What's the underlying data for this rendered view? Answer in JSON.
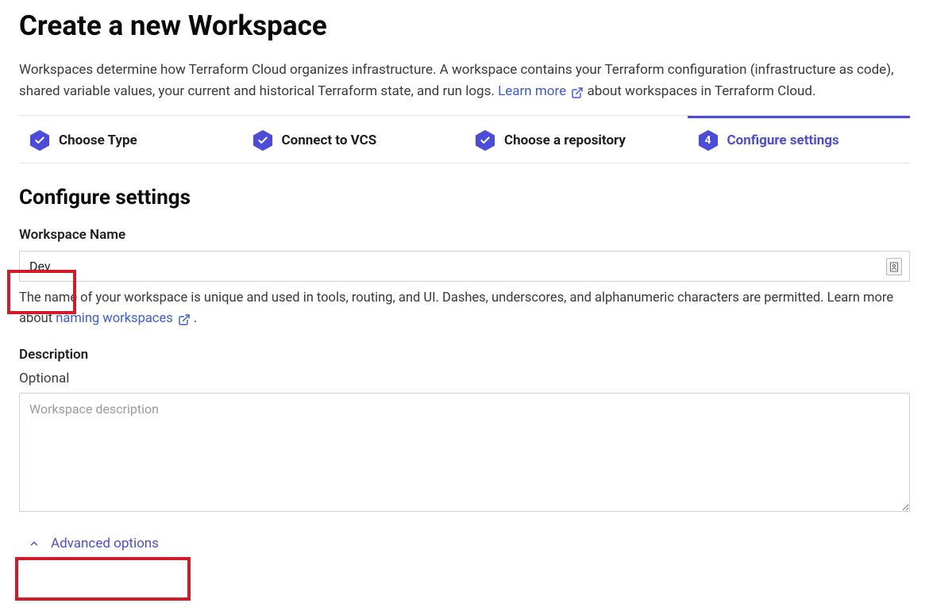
{
  "page": {
    "title": "Create a new Workspace",
    "intro_before": "Workspaces determine how Terraform Cloud organizes infrastructure. A workspace contains your Terraform configuration (infrastructure as code), shared variable values, your current and historical Terraform state, and run logs. ",
    "learn_more": "Learn more",
    "intro_after": " about workspaces in Terraform Cloud."
  },
  "steps": [
    {
      "label": "Choose Type",
      "done": true,
      "active": false
    },
    {
      "label": "Connect to VCS",
      "done": true,
      "active": false
    },
    {
      "label": "Choose a repository",
      "done": true,
      "active": false
    },
    {
      "label": "Configure settings",
      "done": false,
      "active": true,
      "number": "4"
    }
  ],
  "section": {
    "heading": "Configure settings",
    "name_label": "Workspace Name",
    "name_value": "Dev",
    "name_help_before": "The name of your workspace is unique and used in tools, routing, and UI. Dashes, underscores, and alphanumeric characters are permitted. Learn more about ",
    "name_help_link": "naming workspaces",
    "name_help_after": ".",
    "desc_label": "Description",
    "desc_optional": "Optional",
    "desc_placeholder": "Workspace description",
    "advanced_label": "Advanced options"
  },
  "colors": {
    "accent": "#4c4cdb"
  }
}
